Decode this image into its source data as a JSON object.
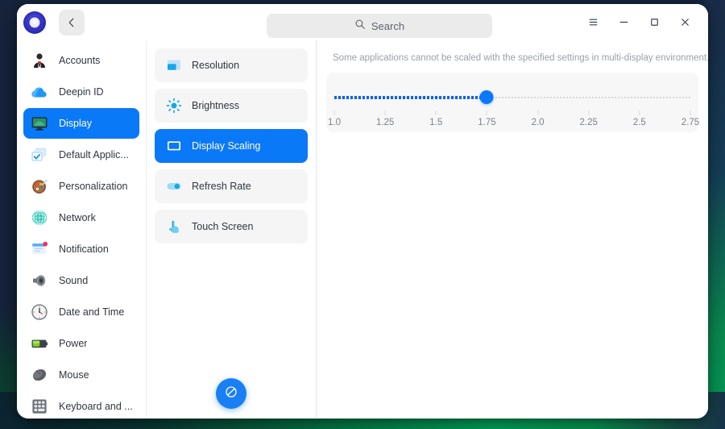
{
  "window": {
    "app_logo": "deepin-logo-icon",
    "back_label": "chevron-left-icon",
    "search": {
      "placeholder": "Search",
      "value": "",
      "icon": "search-icon"
    },
    "controls": {
      "menu": "hamburger-menu-icon",
      "minimize": "minimize-icon",
      "maximize": "maximize-icon",
      "close": "close-icon"
    }
  },
  "sidebar": {
    "items": [
      {
        "label": "Accounts",
        "icon": "accounts-icon",
        "active": false
      },
      {
        "label": "Deepin ID",
        "icon": "cloud-icon",
        "active": false
      },
      {
        "label": "Display",
        "icon": "display-icon",
        "active": true
      },
      {
        "label": "Default Applic...",
        "icon": "default-apps-icon",
        "active": false
      },
      {
        "label": "Personalization",
        "icon": "palette-icon",
        "active": false
      },
      {
        "label": "Network",
        "icon": "network-globe-icon",
        "active": false
      },
      {
        "label": "Notification",
        "icon": "notification-icon",
        "active": false
      },
      {
        "label": "Sound",
        "icon": "speaker-icon",
        "active": false
      },
      {
        "label": "Date and Time",
        "icon": "clock-icon",
        "active": false
      },
      {
        "label": "Power",
        "icon": "battery-icon",
        "active": false
      },
      {
        "label": "Mouse",
        "icon": "mouse-icon",
        "active": false
      },
      {
        "label": "Keyboard and ...",
        "icon": "keyboard-icon",
        "active": false
      }
    ]
  },
  "midpanel": {
    "items": [
      {
        "label": "Resolution",
        "icon": "resolution-icon",
        "active": false
      },
      {
        "label": "Brightness",
        "icon": "brightness-icon",
        "active": false
      },
      {
        "label": "Display Scaling",
        "icon": "display-scaling-icon",
        "active": true
      },
      {
        "label": "Refresh Rate",
        "icon": "refresh-rate-toggle-icon",
        "active": false
      },
      {
        "label": "Touch Screen",
        "icon": "touch-screen-icon",
        "active": false
      }
    ],
    "fab": {
      "icon": "merge-display-icon",
      "label": ""
    }
  },
  "main": {
    "notice": "Some applications cannot be scaled with the specified settings in multi-display environment.",
    "scaling_slider": {
      "name": "display-scaling-slider",
      "value": 1.75,
      "min": 1.0,
      "max": 2.75,
      "ticks": [
        "1.0",
        "1.25",
        "1.5",
        "1.75",
        "2.0",
        "2.25",
        "2.5",
        "2.75"
      ]
    }
  },
  "colors": {
    "accent": "#0a79f7",
    "sidebar_text": "#2f3640",
    "notice_text": "#9aa1ab",
    "card_bg": "#f7f7f8",
    "desktop_green": "#02ab5e"
  }
}
